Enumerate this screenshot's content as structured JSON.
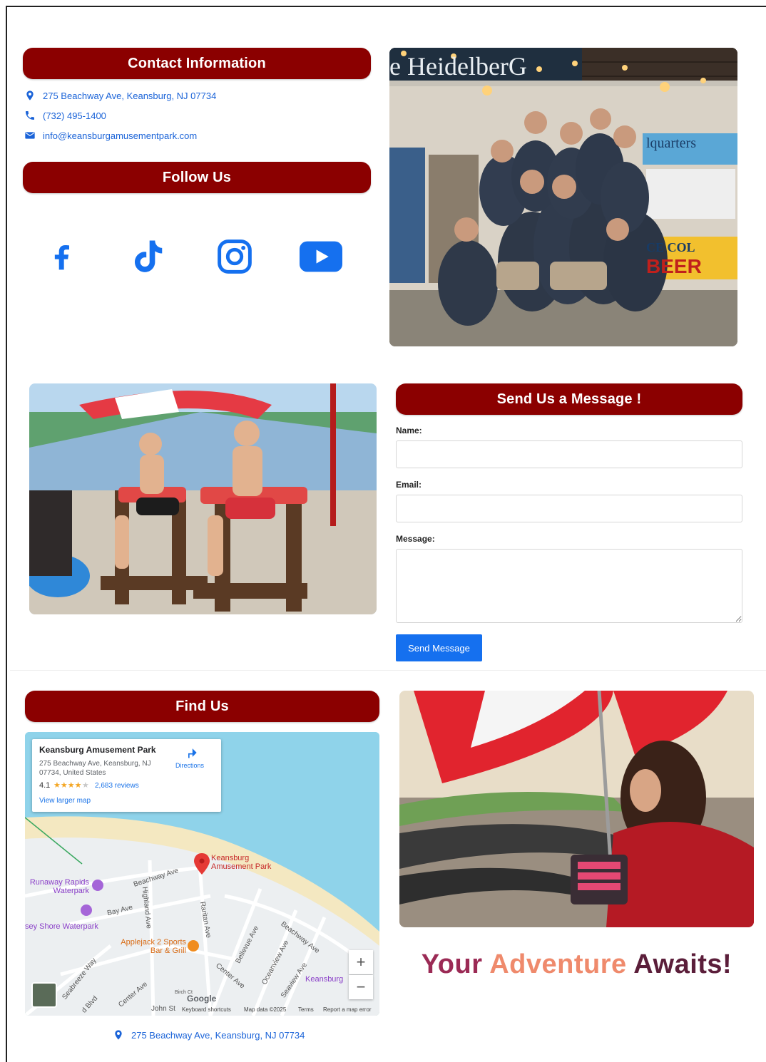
{
  "contact": {
    "heading": "Contact Information",
    "address": "275 Beachway Ave, Keansburg, NJ 07734",
    "phone": "(732) 495-1400",
    "email": "info@keansburgamusementpark.com",
    "icons": [
      "location-pin-icon",
      "phone-icon",
      "envelope-icon"
    ]
  },
  "follow": {
    "heading": "Follow Us",
    "networks": [
      "facebook-icon",
      "tiktok-icon",
      "instagram-icon",
      "youtube-icon"
    ]
  },
  "photos": {
    "staff_sign": "e HeidelberG",
    "beer_sign": "BEER",
    "ice_cold": "CE COL",
    "headquarters": "lquarters"
  },
  "form": {
    "heading": "Send Us a Message !",
    "name_label": "Name:",
    "email_label": "Email:",
    "message_label": "Message:",
    "submit_label": "Send Message"
  },
  "find": {
    "heading": "Find Us",
    "place_name": "Keansburg Amusement Park",
    "place_address": "275 Beachway Ave, Keansburg, NJ 07734, United States",
    "rating": "4.1",
    "stars": "★★★★",
    "star_empty": "★",
    "reviews": "2,683 reviews",
    "directions": "Directions",
    "larger_map": "View larger map",
    "pin_label": "Keansburg Amusement Park",
    "poi": [
      "Runaway Rapids Waterpark",
      "sey Shore Waterpark",
      "Applejack 2 Sports Bar & Grill",
      "Keansburg"
    ],
    "roads": [
      "Beachway Ave",
      "Bay Ave",
      "Highland Ave",
      "Raritan Ave",
      "Bellevue Ave",
      "Oceanview Ave",
      "Beachway Ave",
      "Center Ave",
      "Seaview Ave",
      "Seabreeze Way",
      "Center Ave",
      "d Blvd",
      "John St",
      "Birch Ct"
    ],
    "google": "Google",
    "footer_links": [
      "Keyboard shortcuts",
      "Map data ©2025",
      "Terms",
      "Report a map error"
    ],
    "zoom_in": "+",
    "zoom_out": "−",
    "bottom_address": "275 Beachway Ave, Keansburg, NJ 07734"
  },
  "tagline": {
    "word1": "Your",
    "word2": "Adventure",
    "word3": "Awaits!"
  },
  "colors": {
    "banner": "#8b0000",
    "link": "#1a63d8",
    "social": "#1570ef",
    "button": "#1570ef"
  }
}
